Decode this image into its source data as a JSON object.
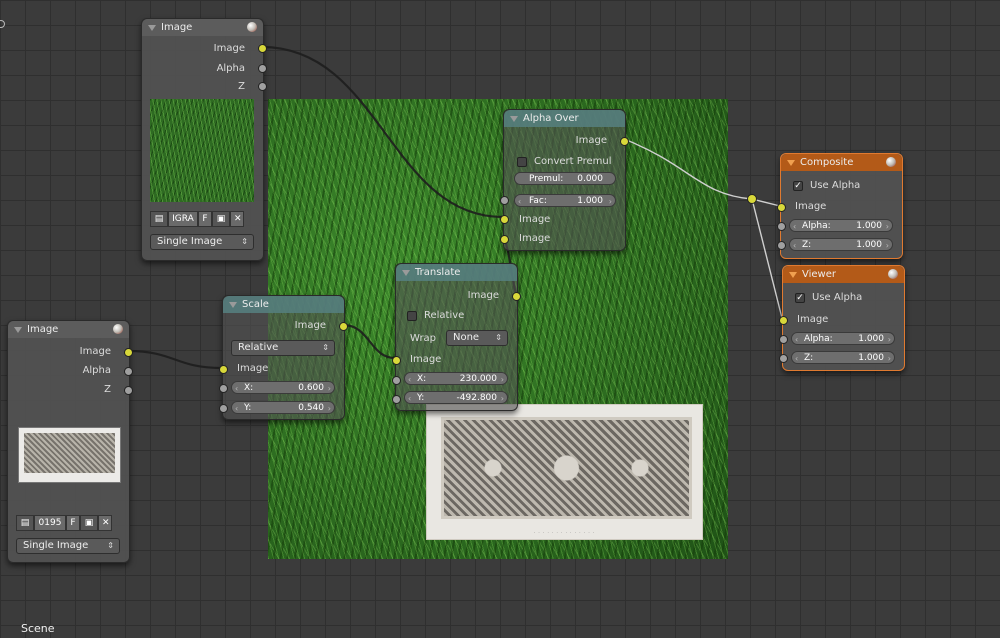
{
  "editor": {
    "scene_label": "Scene"
  },
  "nodes": {
    "image_top": {
      "title": "Image",
      "outputs": [
        "Image",
        "Alpha",
        "Z"
      ],
      "file_field": "IGRA",
      "f_button": "F",
      "source_dropdown": "Single Image"
    },
    "image_bottom": {
      "title": "Image",
      "outputs": [
        "Image",
        "Alpha",
        "Z"
      ],
      "file_field": "0195",
      "f_button": "F",
      "source_dropdown": "Single Image"
    },
    "scale": {
      "title": "Scale",
      "output": "Image",
      "space_dropdown": "Relative",
      "input": "Image",
      "x_label": "X:",
      "x_value": "0.600",
      "y_label": "Y:",
      "y_value": "0.540"
    },
    "translate": {
      "title": "Translate",
      "output": "Image",
      "relative_label": "Relative",
      "wrap_label": "Wrap",
      "wrap_value": "None",
      "input": "Image",
      "x_label": "X:",
      "x_value": "230.000",
      "y_label": "Y:",
      "y_value": "-492.800"
    },
    "alpha_over": {
      "title": "Alpha Over",
      "output": "Image",
      "convert_premul_label": "Convert Premul",
      "premul_label": "Premul:",
      "premul_value": "0.000",
      "fac_label": "Fac:",
      "fac_value": "1.000",
      "input1": "Image",
      "input2": "Image"
    },
    "composite": {
      "title": "Composite",
      "use_alpha_label": "Use Alpha",
      "input": "Image",
      "alpha_label": "Alpha:",
      "alpha_value": "1.000",
      "z_label": "Z:",
      "z_value": "1.000"
    },
    "viewer": {
      "title": "Viewer",
      "use_alpha_label": "Use Alpha",
      "input": "Image",
      "alpha_label": "Alpha:",
      "alpha_value": "1.000",
      "z_label": "Z:",
      "z_value": "1.000"
    }
  },
  "colors": {
    "socket_image": "#d8d83a",
    "socket_value": "#a0a0a0",
    "output_node_header": "#b35a18",
    "link": "#c8c8c8"
  }
}
